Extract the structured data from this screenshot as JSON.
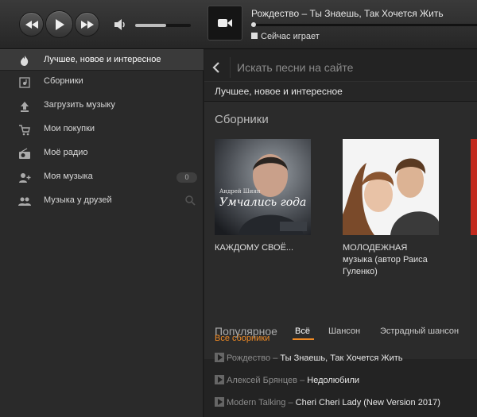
{
  "player": {
    "now_playing_title": "Рождество – Ты Знаешь, Так Хочется Жить",
    "status": "Сейчас играет",
    "volume_percent": 55,
    "progress_percent": 1
  },
  "sidebar": {
    "items": [
      {
        "label": "Лучшее, новое и интересное",
        "icon": "fire-icon",
        "active": true
      },
      {
        "label": "Сборники",
        "icon": "collections-icon"
      },
      {
        "label": "Загрузить музыку",
        "icon": "upload-icon"
      },
      {
        "label": "Мои покупки",
        "icon": "cart-icon"
      },
      {
        "label": "Моё радио",
        "icon": "radio-icon"
      },
      {
        "label": "Моя музыка",
        "icon": "add-user-icon",
        "badge": "0"
      },
      {
        "label": "Музыка у друзей",
        "icon": "friends-icon"
      }
    ]
  },
  "search": {
    "placeholder": "Искать песни на сайте"
  },
  "main": {
    "section_title": "Лучшее, новое и интересное",
    "collections_title": "Сборники",
    "albums": [
      {
        "caption": "КАЖДОМУ СВОЁ...",
        "cover_text": "Умчались года",
        "cover_author": "Андрей Шиян"
      },
      {
        "caption": "МОЛОДЕЖНАЯ музыка (автор Раиса Гуленко)"
      }
    ],
    "all_collections_link": "Все сборники",
    "popular_title": "Популярное",
    "popular_tabs": [
      {
        "label": "Всё",
        "active": true
      },
      {
        "label": "Шансон"
      },
      {
        "label": "Эстрадный шансон"
      }
    ],
    "tracks": [
      {
        "artist": "Рождество",
        "song": "Ты Знаешь, Так Хочется Жить"
      },
      {
        "artist": "Алексей Брянцев",
        "song": "Недолюбили"
      },
      {
        "artist": "Modern Talking",
        "song": "Cheri Cheri Lady (New Version 2017)"
      }
    ],
    "track_separator": "–"
  },
  "colors": {
    "accent": "#f08a24",
    "background": "#232323",
    "sidebar": "#2a2a2a"
  }
}
